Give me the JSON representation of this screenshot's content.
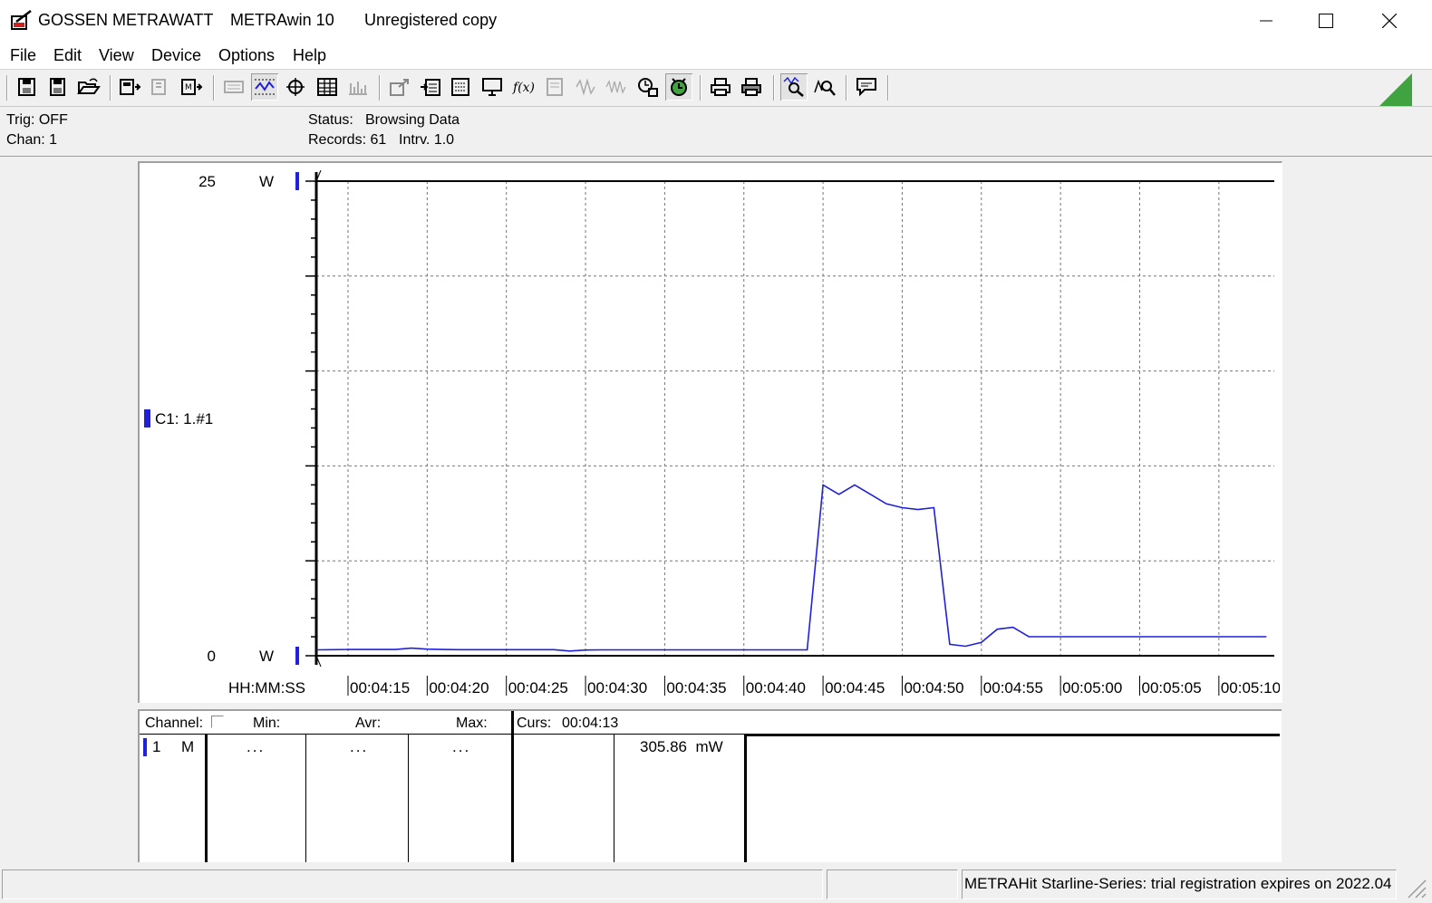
{
  "window": {
    "brand": "GOSSEN METRAWATT",
    "app_name": "METRAwin 10",
    "registration": "Unregistered copy"
  },
  "menu": [
    "File",
    "Edit",
    "View",
    "Device",
    "Options",
    "Help"
  ],
  "info": {
    "trig": "Trig: OFF",
    "chan": "Chan:  1",
    "status_label": "Status:",
    "status_value": "Browsing Data",
    "records": "Records: 61",
    "interval": "Intrv. 1.0"
  },
  "chart": {
    "legend_label": "C1: 1.#1",
    "unit_top": "W",
    "unit_bottom": "W"
  },
  "chart_data": {
    "type": "line",
    "title": "",
    "xlabel": "HH:MM:SS",
    "ylabel": "",
    "ylim": [
      0,
      25
    ],
    "y_tick_labels": [
      "25",
      "0"
    ],
    "x_tick_labels": [
      "00:04:15",
      "00:04:20",
      "00:04:25",
      "00:04:30",
      "00:04:35",
      "00:04:40",
      "00:04:45",
      "00:04:50",
      "00:04:55",
      "00:05:00",
      "00:05:05",
      "00:05:10"
    ],
    "grid": true,
    "series": [
      {
        "color": "#2020dd",
        "x_seconds_start": 253,
        "values": [
          0.31,
          0.32,
          0.33,
          0.33,
          0.33,
          0.33,
          0.4,
          0.35,
          0.33,
          0.32,
          0.32,
          0.32,
          0.32,
          0.32,
          0.32,
          0.32,
          0.25,
          0.3,
          0.31,
          0.31,
          0.31,
          0.31,
          0.31,
          0.31,
          0.31,
          0.31,
          0.31,
          0.31,
          0.31,
          0.31,
          0.31,
          0.31,
          9.0,
          8.5,
          9.0,
          8.5,
          8.0,
          7.8,
          7.7,
          7.8,
          0.6,
          0.5,
          0.7,
          1.4,
          1.5,
          1.0,
          1.0,
          1.0,
          1.0,
          1.0,
          1.0,
          1.0,
          1.0,
          1.0,
          1.0,
          1.0,
          1.0,
          1.0,
          1.0,
          1.0,
          1.0
        ]
      }
    ]
  },
  "table": {
    "headers": {
      "channel": "Channel:",
      "min": "Min:",
      "avr": "Avr:",
      "max": "Max:",
      "curs": "Curs:",
      "curs_time": "00:04:13"
    },
    "rows": [
      {
        "channel": "1",
        "mode": "M",
        "min": "...",
        "avr": "...",
        "max": "...",
        "cursor_value": "305.86  mW"
      }
    ]
  },
  "statusbar": {
    "message": "METRAHit Starline-Series: trial registration expires on 2022.04"
  },
  "colors": {
    "series": "#2020dd",
    "accent_green": "#3fa33f"
  }
}
